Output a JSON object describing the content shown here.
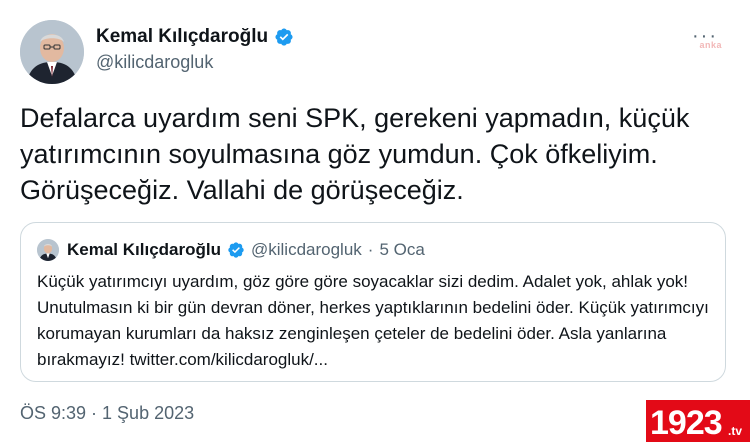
{
  "author": {
    "display_name": "Kemal Kılıçdaroğlu",
    "handle": "@kilicdarogluk",
    "verified": true
  },
  "more_icon": "more-dots-icon",
  "watermark_top": "anka",
  "tweet_text": "Defalarca uyardım seni SPK, gerekeni yapmadın, küçük yatırımcının soyulmasına göz yumdun. Çok öfkeliyim. Görüşeceğiz. Vallahi de görüşeceğiz.",
  "quoted": {
    "display_name": "Kemal Kılıçdaroğlu",
    "handle": "@kilicdarogluk",
    "separator": "·",
    "date": "5 Oca",
    "text": "Küçük yatırımcıyı uyardım, göz göre göre soyacaklar sizi dedim. Adalet yok, ahlak yok! Unutulmasın ki bir gün devran döner, herkes yaptıklarının bedelini öder. Küçük yatırımcıyı korumayan kurumları da haksız zenginleşen çeteler de bedelini öder. Asla yanlarına bırakmayız! twitter.com/kilicdarogluk/..."
  },
  "timestamp": "ÖS 9:39 · 1 Şub 2023",
  "logo": "1923.tv",
  "colors": {
    "verified": "#1d9bf0",
    "secondary_text": "#536471",
    "border": "#cfd9de",
    "logo_bg": "#e30a17"
  }
}
